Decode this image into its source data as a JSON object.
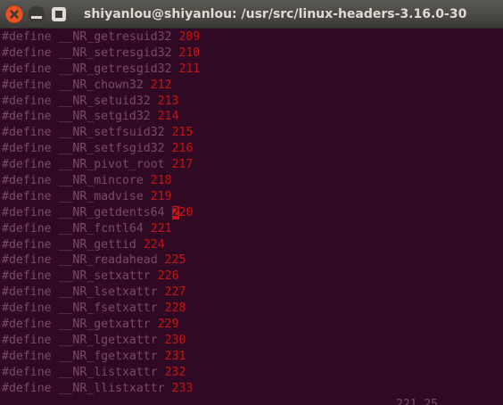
{
  "window": {
    "title": "shiyanlou@shiyanlou: /usr/src/linux-headers-3.16.0-30",
    "buttons": [
      "close",
      "minimize",
      "maximize"
    ],
    "colors": {
      "background": "#300a24",
      "titlebar": "#3c3b37",
      "close": "#e95420",
      "text_dim": "#7a4a6e",
      "number": "#c01818"
    }
  },
  "terminal": {
    "lines": [
      {
        "kw": "#define",
        "name": "__NR_getresuid32",
        "num": "209"
      },
      {
        "kw": "#define",
        "name": "__NR_setresgid32",
        "num": "210"
      },
      {
        "kw": "#define",
        "name": "__NR_getresgid32",
        "num": "211"
      },
      {
        "kw": "#define",
        "name": "__NR_chown32",
        "num": "212"
      },
      {
        "kw": "#define",
        "name": "__NR_setuid32",
        "num": "213"
      },
      {
        "kw": "#define",
        "name": "__NR_setgid32",
        "num": "214"
      },
      {
        "kw": "#define",
        "name": "__NR_setfsuid32",
        "num": "215"
      },
      {
        "kw": "#define",
        "name": "__NR_setfsgid32",
        "num": "216"
      },
      {
        "kw": "#define",
        "name": "__NR_pivot_root",
        "num": "217"
      },
      {
        "kw": "#define",
        "name": "__NR_mincore",
        "num": "218"
      },
      {
        "kw": "#define",
        "name": "__NR_madvise",
        "num": "219"
      },
      {
        "kw": "#define",
        "name": "__NR_getdents64",
        "num": "220",
        "cursor": true
      },
      {
        "kw": "#define",
        "name": "__NR_fcntl64",
        "num": "221"
      },
      {
        "kw": "#define",
        "name": "__NR_gettid",
        "num": "224"
      },
      {
        "kw": "#define",
        "name": "__NR_readahead",
        "num": "225"
      },
      {
        "kw": "#define",
        "name": "__NR_setxattr",
        "num": "226"
      },
      {
        "kw": "#define",
        "name": "__NR_lsetxattr",
        "num": "227"
      },
      {
        "kw": "#define",
        "name": "__NR_fsetxattr",
        "num": "228"
      },
      {
        "kw": "#define",
        "name": "__NR_getxattr",
        "num": "229"
      },
      {
        "kw": "#define",
        "name": "__NR_lgetxattr",
        "num": "230"
      },
      {
        "kw": "#define",
        "name": "__NR_fgetxattr",
        "num": "231"
      },
      {
        "kw": "#define",
        "name": "__NR_listxattr",
        "num": "232"
      },
      {
        "kw": "#define",
        "name": "__NR_llistxattr",
        "num": "233"
      }
    ],
    "status": "221,25"
  }
}
